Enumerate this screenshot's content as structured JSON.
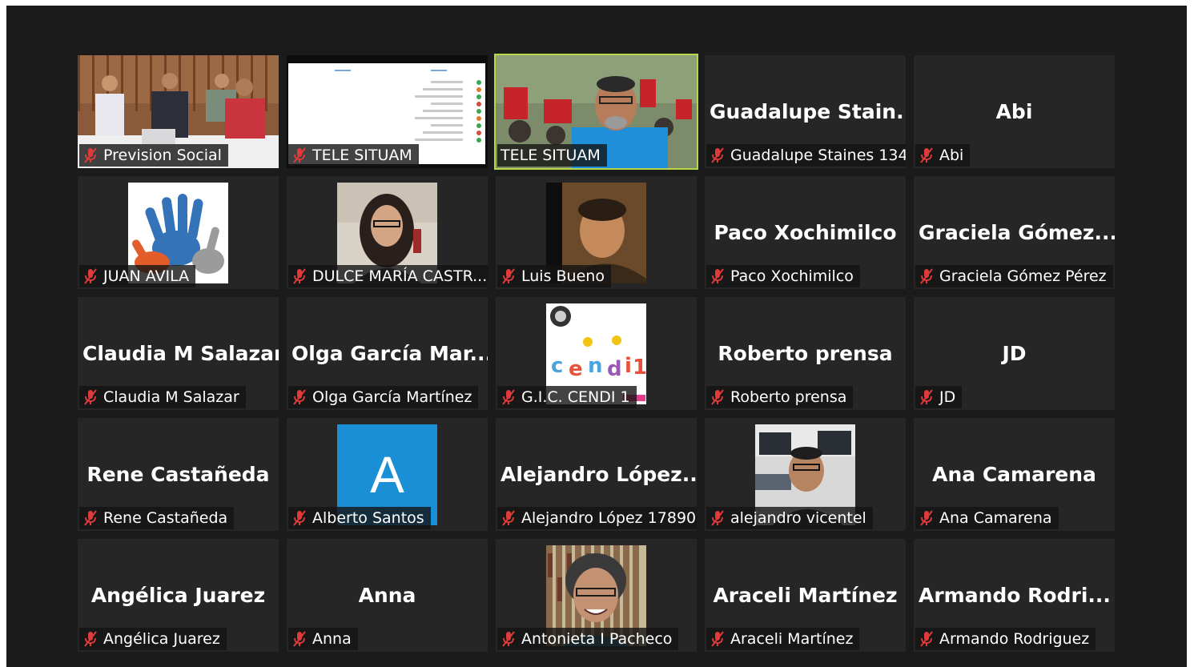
{
  "colors": {
    "window_bg": "#1b1b1b",
    "tile_bg": "#262626",
    "active_speaker_border": "#b6d847",
    "muted_mic": "#e03b3b",
    "text": "#ffffff"
  },
  "participants": [
    {
      "display": "video",
      "picture": "conference-room-panel",
      "tag": "Prevision Social",
      "muted": true
    },
    {
      "display": "video",
      "picture": "shared-document",
      "tag": "TELE SITUAM",
      "muted": true
    },
    {
      "display": "video",
      "picture": "protest-selfie",
      "tag": "TELE SITUAM",
      "muted": false,
      "active_speaker": true
    },
    {
      "display": "name",
      "big_name": "Guadalupe  Stain...",
      "tag": "Guadalupe Staines 134...",
      "muted": true
    },
    {
      "display": "name",
      "big_name": "Abi",
      "tag": "Abi",
      "muted": true
    },
    {
      "display": "video",
      "picture": "hands-logo",
      "tag": "JUAN AVILA",
      "muted": true
    },
    {
      "display": "video",
      "picture": "woman-portrait",
      "tag": "DULCE MARÍA CASTR...",
      "muted": true
    },
    {
      "display": "video",
      "picture": "man-photo",
      "tag": "Luis Bueno",
      "muted": true
    },
    {
      "display": "name",
      "big_name": "Paco Xochimilco",
      "tag": "Paco Xochimilco",
      "muted": true
    },
    {
      "display": "name",
      "big_name": "Graciela  Gómez...",
      "tag": "Graciela Gómez Pérez",
      "muted": true
    },
    {
      "display": "name",
      "big_name": "Claudia M Salazar",
      "tag": "Claudia M Salazar",
      "muted": true
    },
    {
      "display": "name",
      "big_name": "Olga  García  Mar...",
      "tag": "Olga García Martínez",
      "muted": true
    },
    {
      "display": "video",
      "picture": "cendi-logo",
      "tag": "G.I.C. CENDI 1",
      "muted": true
    },
    {
      "display": "name",
      "big_name": "Roberto prensa",
      "tag": "Roberto prensa",
      "muted": true
    },
    {
      "display": "name",
      "big_name": "JD",
      "tag": "JD",
      "muted": true
    },
    {
      "display": "name",
      "big_name": "Rene Castañeda",
      "tag": "Rene Castañeda",
      "muted": true
    },
    {
      "display": "video",
      "picture": "letter-avatar",
      "avatar_letter": "A",
      "avatar_color": "#1b8fd6",
      "tag": "Alberto Santos",
      "muted": true
    },
    {
      "display": "name",
      "big_name": "Alejandro  López...",
      "tag": "Alejandro López 17890...",
      "muted": true
    },
    {
      "display": "video",
      "picture": "studio-man",
      "tag": "alejandro vicentel",
      "muted": true
    },
    {
      "display": "name",
      "big_name": "Ana Camarena",
      "tag": "Ana Camarena",
      "muted": true
    },
    {
      "display": "name",
      "big_name": "Angélica Juarez",
      "tag": "Angélica Juarez",
      "muted": true
    },
    {
      "display": "name",
      "big_name": "Anna",
      "tag": "Anna",
      "muted": true
    },
    {
      "display": "video",
      "picture": "woman-glasses",
      "tag": "Antonieta I Pacheco",
      "muted": true
    },
    {
      "display": "name",
      "big_name": "Araceli Martínez",
      "tag": "Araceli Martínez",
      "muted": true
    },
    {
      "display": "name",
      "big_name": "Armando  Rodri...",
      "tag": "Armando Rodriguez",
      "muted": true
    }
  ]
}
